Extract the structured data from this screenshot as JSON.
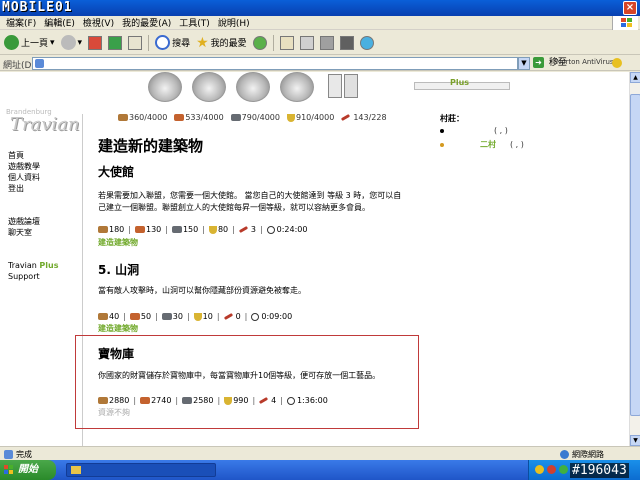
{
  "titlebar": {
    "brand": "MOBILE01",
    "close": "×"
  },
  "menu": [
    "檔案(F)",
    "編輯(E)",
    "檢視(V)",
    "我的最愛(A)",
    "工具(T)",
    "說明(H)"
  ],
  "toolbar": {
    "back": "上一頁",
    "search": "搜尋",
    "favorites": "我的最愛"
  },
  "address": {
    "label": "網址(D)",
    "go": "移至",
    "norton": "Norton AntiVirus"
  },
  "top_nav": {
    "plus": "Plus"
  },
  "logo": {
    "top": "Brandenburg",
    "main": "Travian"
  },
  "left_nav": {
    "items1": [
      "首頁",
      "遊戲教學",
      "個人資料",
      "登出"
    ],
    "items2": [
      "遊戲論壇",
      "聊天室"
    ],
    "travian": "Travian",
    "plus": "Plus",
    "support": "Support"
  },
  "resources": {
    "wood": "360/4000",
    "clay": "533/4000",
    "iron": "790/4000",
    "crop": "910/4000",
    "upkeep": "143/228"
  },
  "page_title": "建造新的建築物",
  "buildings": [
    {
      "name": "大使館",
      "desc1": "若果需要加入聯盟，您需要一個大使館。 當您自己的大使館達到 等級 3 時，您可以自",
      "desc2": "己建立一個聯盟。聯盟創立人的大使館每昇一個等級，就可以容納更多會員。",
      "wood": "180",
      "clay": "130",
      "iron": "150",
      "crop": "80",
      "upkeep": "3",
      "time": "0:24:00",
      "action": "建造建築物"
    },
    {
      "name": "5. 山洞",
      "desc1": "當有敵人攻擊時，山洞可以幫你隱藏部份資源避免被奪走。",
      "wood": "40",
      "clay": "50",
      "iron": "30",
      "crop": "10",
      "upkeep": "0",
      "time": "0:09:00",
      "action": "建造建築物"
    },
    {
      "name": "寶物庫",
      "desc1": "你國家的財寶儲存於寶物庫中，每當寶物庫升10個等級，便可存放一個工藝品。",
      "wood": "2880",
      "clay": "2740",
      "iron": "2580",
      "crop": "990",
      "upkeep": "4",
      "time": "1:36:00",
      "action": "資源不夠"
    }
  ],
  "villages": {
    "title": "村莊：",
    "list": [
      {
        "name": "",
        "coord": "(    ,    )"
      },
      {
        "name": "二村",
        "coord": "(    ,    )"
      }
    ]
  },
  "status": {
    "left": "完成",
    "right": "網際網路"
  },
  "taskbar": {
    "start": "開始"
  },
  "watermark": "#196043"
}
